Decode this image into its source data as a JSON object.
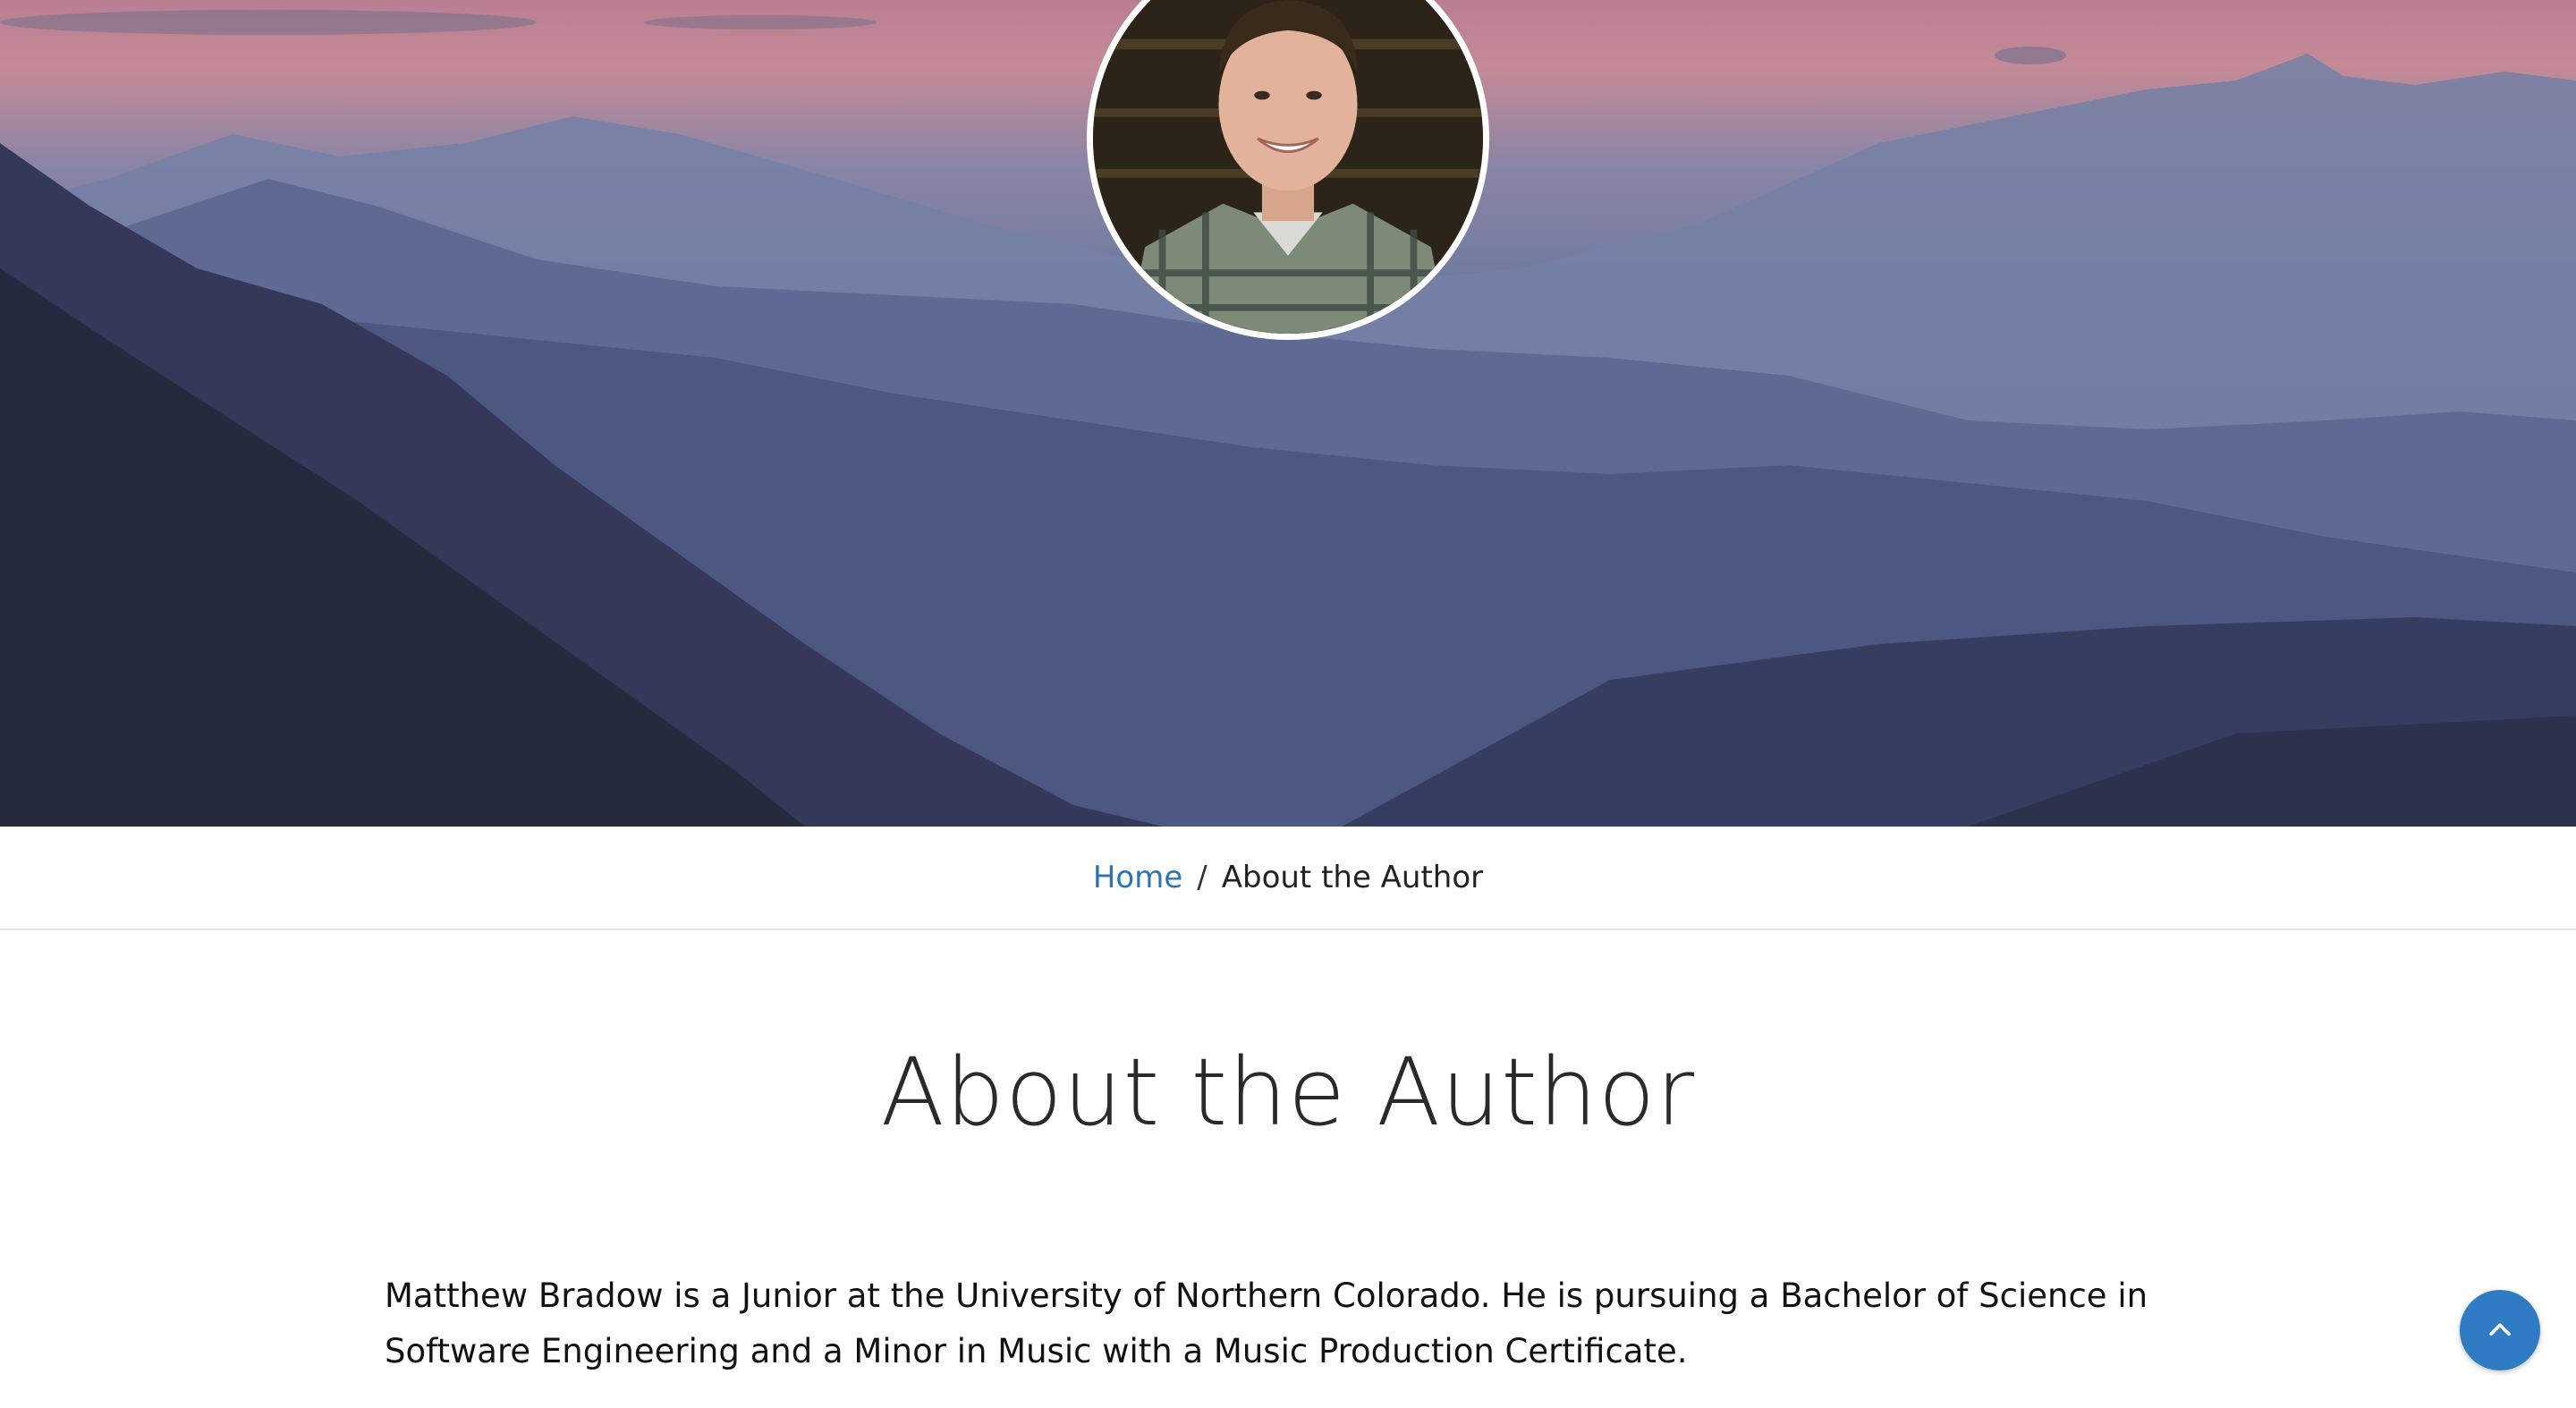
{
  "hero": {
    "background": "mountain-range-at-dusk",
    "avatar_alt": "author-portrait"
  },
  "breadcrumb": {
    "home_label": "Home",
    "separator": "/",
    "current_label": "About the Author"
  },
  "page": {
    "title": "About the Author",
    "bio": "Matthew Bradow is a Junior at the University of Northern Colorado. He is pursuing a Bachelor of Science in Software Engineering and a Minor in Music with a Music Production Certificate."
  },
  "back_to_top": {
    "icon": "chevron-up-icon",
    "color": "#2f7bc4"
  },
  "colors": {
    "link": "#2b75b5",
    "text": "#111111",
    "divider": "#e2e2e2"
  }
}
